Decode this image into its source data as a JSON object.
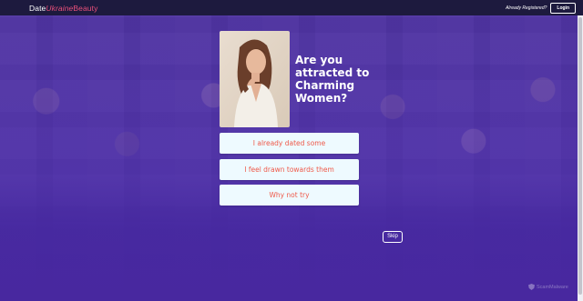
{
  "header": {
    "logo": {
      "part1": "Date",
      "part2": "Ukraine",
      "part3": "Beauty"
    },
    "already_registered": "Already Registered?",
    "login_label": "Login"
  },
  "quiz": {
    "question": "Are you attracted to Charming Women?",
    "answers": [
      {
        "label": "I already dated some"
      },
      {
        "label": "I feel drawn towards them"
      },
      {
        "label": "Why not try"
      }
    ],
    "skip_label": "Skip"
  },
  "watermark": {
    "text": "ScamMalware"
  },
  "colors": {
    "header_bg": "#1d1a3e",
    "background": "#5a3ea6",
    "accent": "#e8507a",
    "answer_bg": "#eefaff",
    "answer_text": "#ef5a4a"
  }
}
